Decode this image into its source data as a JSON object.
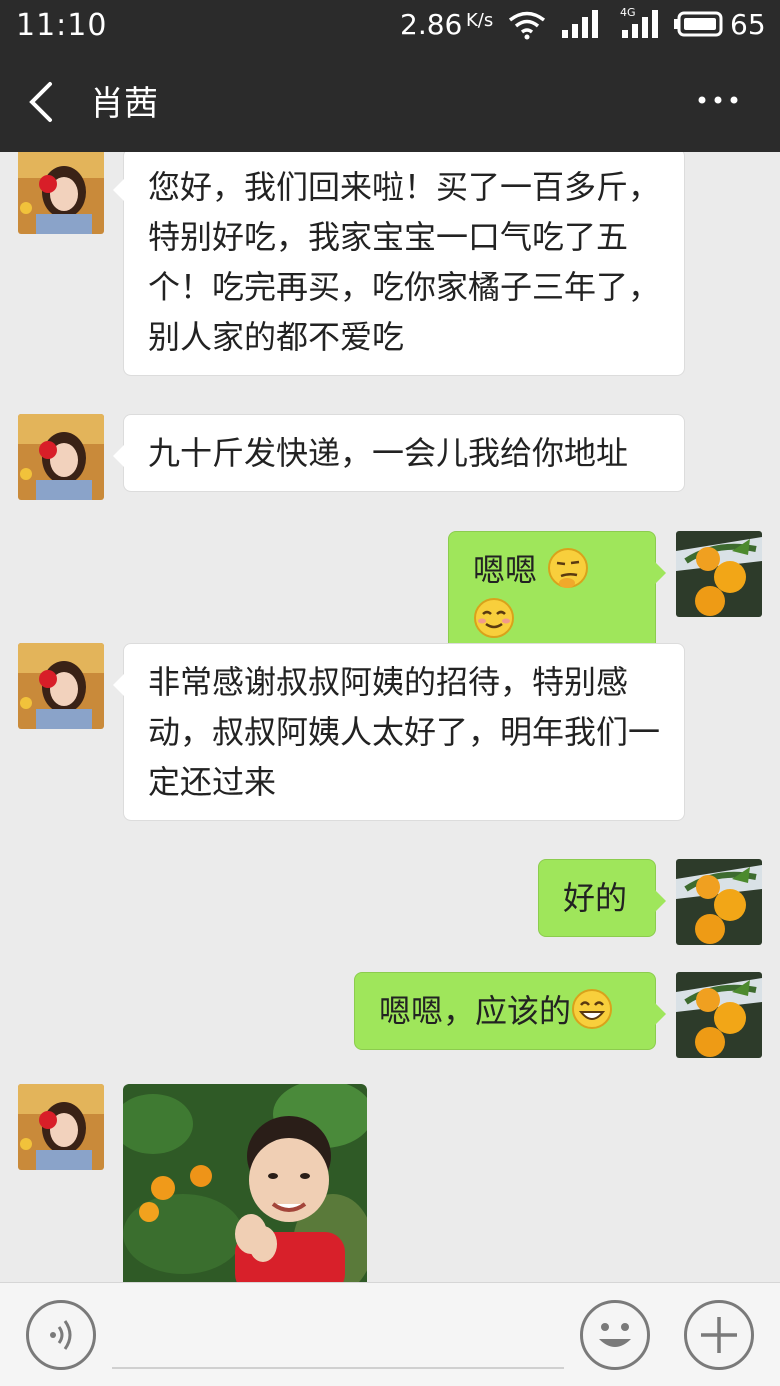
{
  "status_bar": {
    "time": "11:10",
    "speed": "2.86",
    "speed_unit": "K/s",
    "network": "4G",
    "battery": "65"
  },
  "header": {
    "title": "肖茜"
  },
  "messages": [
    {
      "side": "left",
      "text": "您好，我们回来啦！买了一百多斤，特别好吃，我家宝宝一口气吃了五个！吃完再买，吃你家橘子三年了，别人家的都不爱吃"
    },
    {
      "side": "left",
      "text": "九十斤发快递，一会儿我给你地址"
    },
    {
      "side": "right",
      "text": "嗯嗯",
      "emojis": [
        "smirk-face-icon",
        "blush-face-icon"
      ]
    },
    {
      "side": "left",
      "text": "非常感谢叔叔阿姨的招待，特别感动，叔叔阿姨人太好了，明年我们一定还过来"
    },
    {
      "side": "right",
      "text": "好的"
    },
    {
      "side": "right",
      "text": "嗯嗯，应该的",
      "emojis": [
        "grin-face-icon"
      ]
    },
    {
      "side": "left",
      "type": "image",
      "description": "child-photo"
    }
  ],
  "colors": {
    "bar_bg": "#2b2b2b",
    "chat_bg": "#ebebeb",
    "my_bubble": "#9fe65b",
    "their_bubble": "#ffffff"
  }
}
